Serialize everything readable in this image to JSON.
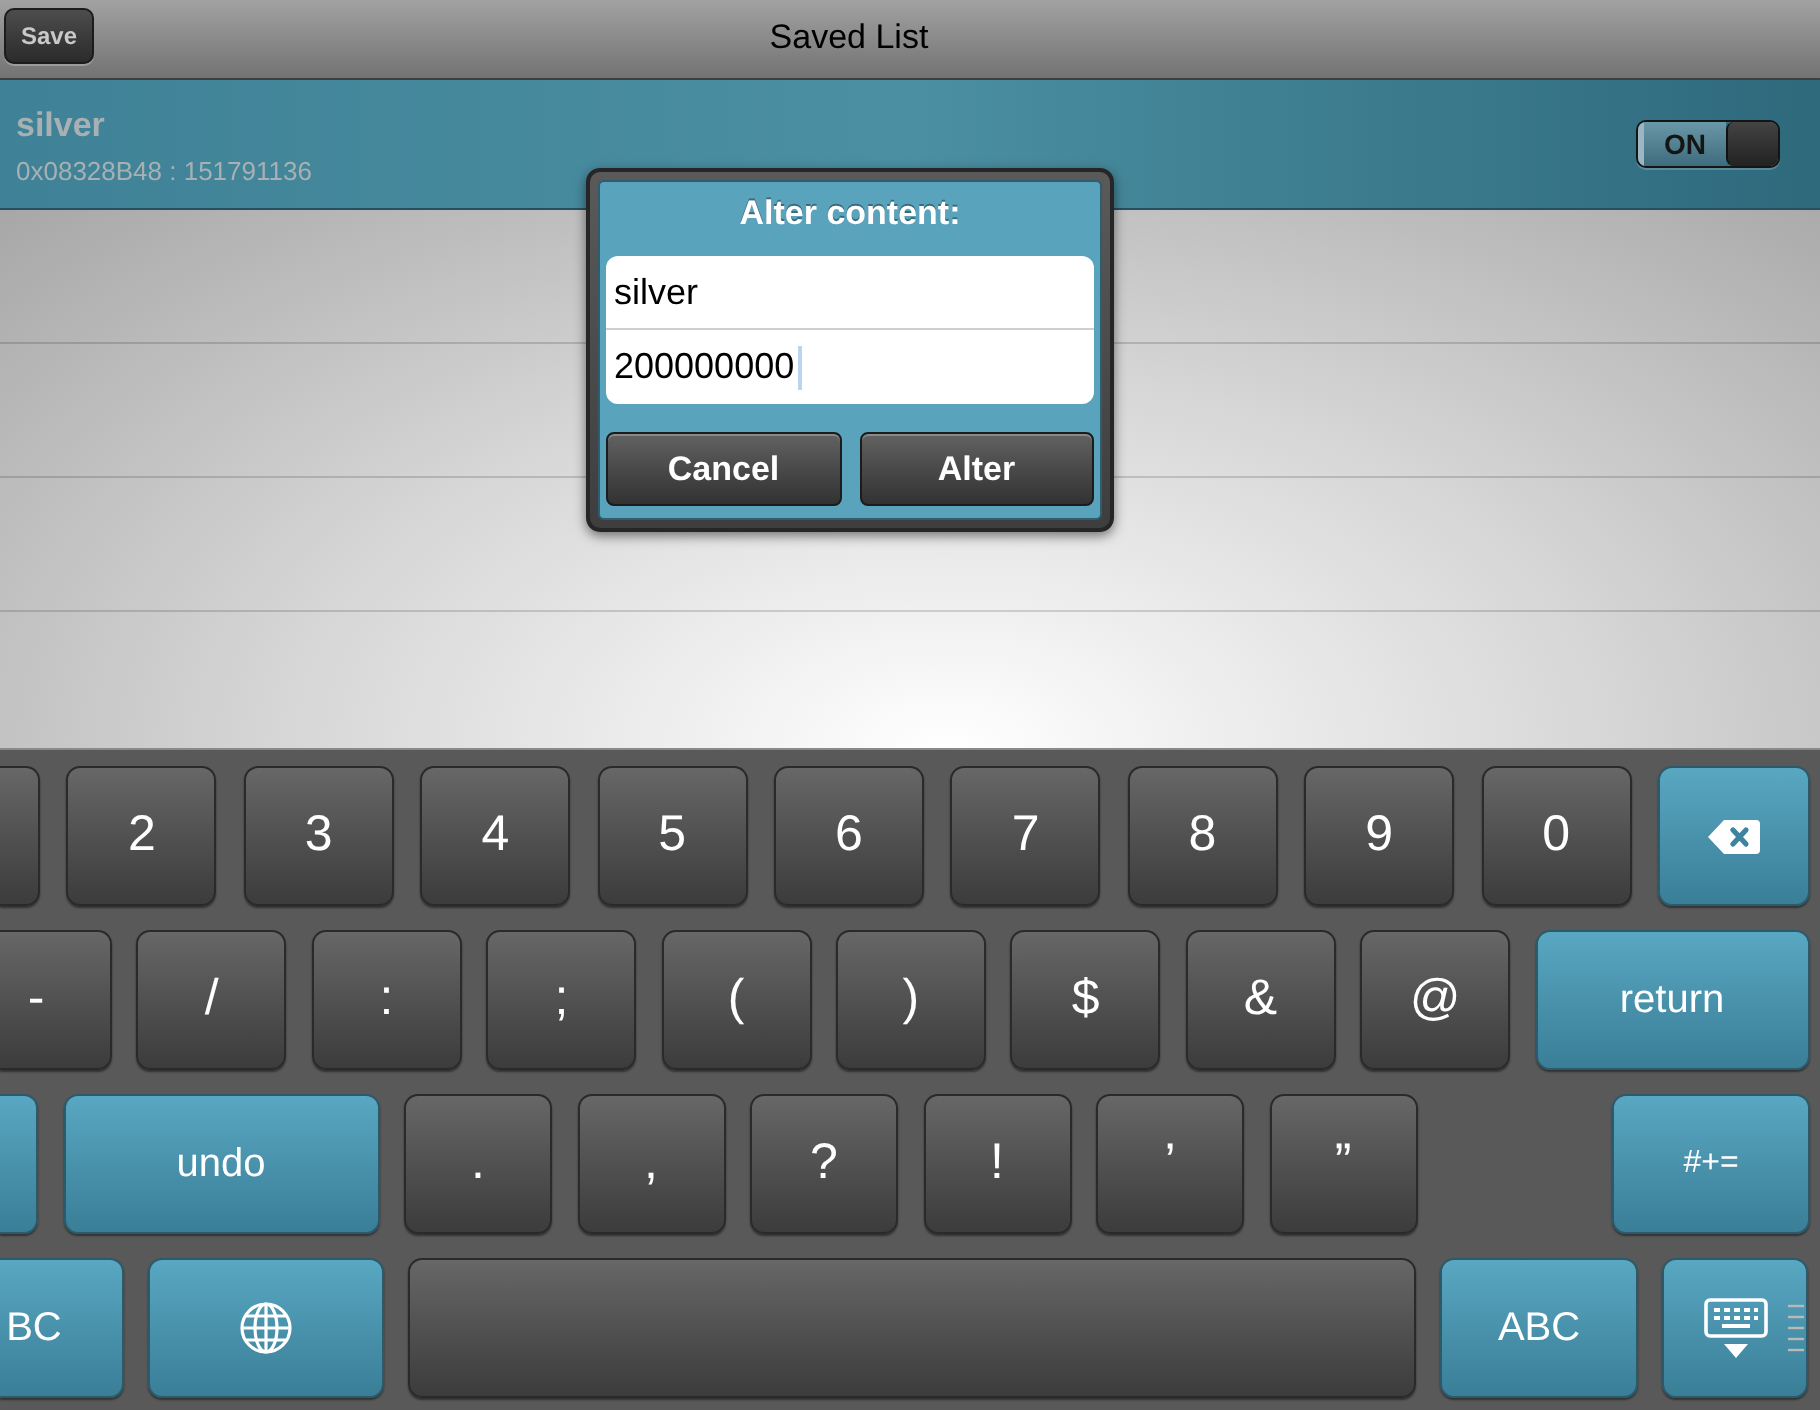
{
  "nav_bar": {
    "save_button": "Save",
    "title": "Saved List"
  },
  "saved_items": [
    {
      "name": "silver",
      "detail": "0x08328B48 : 151791136",
      "switch": {
        "label": "ON",
        "on": true
      }
    }
  ],
  "dialog": {
    "title": "Alter content:",
    "fields": [
      {
        "value": "silver",
        "focused": false
      },
      {
        "value": "200000000",
        "focused": true
      }
    ],
    "buttons": [
      "Cancel",
      "Alter"
    ]
  },
  "keyboard": {
    "rows": [
      [
        {
          "kind": "char"
        },
        {
          "kind": "char",
          "label": "2"
        },
        {
          "kind": "char",
          "label": "3"
        },
        {
          "kind": "char",
          "label": "4"
        },
        {
          "kind": "char",
          "label": "5"
        },
        {
          "kind": "char",
          "label": "6"
        },
        {
          "kind": "char",
          "label": "7"
        },
        {
          "kind": "char",
          "label": "8"
        },
        {
          "kind": "char",
          "label": "9"
        },
        {
          "kind": "char",
          "label": "0"
        },
        {
          "kind": "delete"
        }
      ],
      [
        {
          "kind": "char",
          "label": "-"
        },
        {
          "kind": "char",
          "label": "/"
        },
        {
          "kind": "char",
          "label": ":"
        },
        {
          "kind": "char",
          "label": ";"
        },
        {
          "kind": "char",
          "label": "("
        },
        {
          "kind": "char",
          "label": ")"
        },
        {
          "kind": "char",
          "label": "$"
        },
        {
          "kind": "char",
          "label": "&"
        },
        {
          "kind": "char",
          "label": "@"
        },
        {
          "kind": "action",
          "label": "return"
        }
      ],
      [
        {
          "kind": "shift"
        },
        {
          "kind": "action",
          "label": "undo"
        },
        {
          "kind": "char",
          "label": "."
        },
        {
          "kind": "char",
          "label": ","
        },
        {
          "kind": "char",
          "label": "?"
        },
        {
          "kind": "char",
          "label": "!"
        },
        {
          "kind": "char",
          "label": "’"
        },
        {
          "kind": "char",
          "label": "”"
        },
        {
          "kind": "shift",
          "label": "#+="
        }
      ],
      [
        {
          "kind": "action",
          "label": "BC"
        },
        {
          "kind": "globe"
        },
        {
          "kind": "space"
        },
        {
          "kind": "action",
          "label": "ABC"
        },
        {
          "kind": "dismiss"
        }
      ]
    ]
  }
}
